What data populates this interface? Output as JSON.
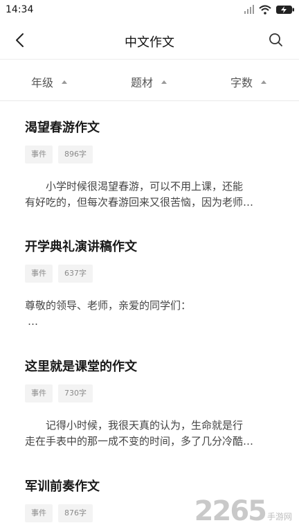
{
  "status_bar": {
    "time": "14:34"
  },
  "nav": {
    "title": "中文作文"
  },
  "filters": [
    {
      "label": "年级"
    },
    {
      "label": "题材"
    },
    {
      "label": "字数"
    }
  ],
  "articles": [
    {
      "title": "渴望春游作文",
      "tags": [
        "事件",
        "896字"
      ],
      "excerpt_lines": [
        "小学时候很渴望春游，可以不用上课，还能",
        "有好吃的，但每次春游回来又很苦恼，因为老师…"
      ]
    },
    {
      "title": "开学典礼演讲稿作文",
      "tags": [
        "事件",
        "637字"
      ],
      "excerpt_lines": [
        "尊敬的领导、老师，亲爱的同学们：",
        "…"
      ]
    },
    {
      "title": "这里就是课堂的作文",
      "tags": [
        "事件",
        "730字"
      ],
      "excerpt_lines": [
        "记得小时候，我很天真的认为，生命就是行",
        "走在手表中的那一成不变的时间，多了几分冷酷…"
      ]
    },
    {
      "title": "军训前奏作文",
      "tags": [
        "事件",
        "876字"
      ],
      "excerpt_lines": []
    }
  ],
  "watermark": {
    "digits": "2265",
    "text": "手游网"
  }
}
